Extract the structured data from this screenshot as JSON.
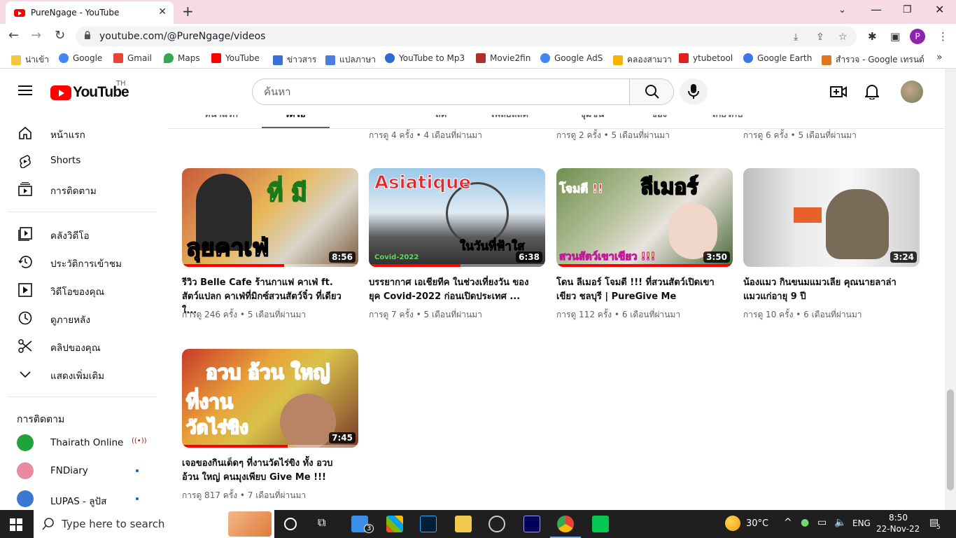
{
  "browser": {
    "tab_title": "PureNgage - YouTube",
    "url": "youtube.com/@PureNgage/videos",
    "profile_letter": "P",
    "bookmarks": [
      {
        "label": "น่าเข้า",
        "color": "#f4c542"
      },
      {
        "label": "Google",
        "color": "#4285f4"
      },
      {
        "label": "Gmail",
        "color": "#ea4335"
      },
      {
        "label": "Maps",
        "color": "#34a853"
      },
      {
        "label": "YouTube",
        "color": "#ff0000"
      },
      {
        "label": "ข่าวสาร",
        "color": "#3b6fd8"
      },
      {
        "label": "แปลภาษา",
        "color": "#4a7ee0"
      },
      {
        "label": "YouTube to Mp3",
        "color": "#2a6ad1"
      },
      {
        "label": "Movie2fin",
        "color": "#b0302a"
      },
      {
        "label": "Google AdS",
        "color": "#4285f4"
      },
      {
        "label": "คลองสามวา",
        "color": "#f4b400"
      },
      {
        "label": "ytubetool",
        "color": "#e02020"
      },
      {
        "label": "Google Earth",
        "color": "#3b78e7"
      },
      {
        "label": "สำรวจ - Google เทรนด์",
        "color": "#e0761f"
      }
    ]
  },
  "header": {
    "logo_text": "YouTube",
    "country_code": "TH",
    "search_placeholder": "ค้นหา"
  },
  "sidebar": {
    "primary": [
      {
        "label": "หน้าแรก",
        "icon": "home-icon"
      },
      {
        "label": "Shorts",
        "icon": "shorts-icon"
      },
      {
        "label": "การติดตาม",
        "icon": "subscriptions-icon"
      }
    ],
    "library": [
      {
        "label": "คลังวิดีโอ",
        "icon": "library-icon"
      },
      {
        "label": "ประวัติการเข้าชม",
        "icon": "history-icon"
      },
      {
        "label": "วิดีโอของคุณ",
        "icon": "your-videos-icon"
      },
      {
        "label": "ดูภายหลัง",
        "icon": "watch-later-icon"
      },
      {
        "label": "คลิปของคุณ",
        "icon": "clips-icon"
      },
      {
        "label": "แสดงเพิ่มเติม",
        "icon": "chevron-down-icon"
      }
    ],
    "subscriptions_title": "การติดตาม",
    "subscriptions": [
      {
        "name": "Thairath Online",
        "status": "live",
        "live_glyph": "((•))",
        "color": "#1fa33a"
      },
      {
        "name": "FNDiary",
        "status": "new",
        "color": "#e88aa0"
      },
      {
        "name": "LUPAS - ลูปัส",
        "status": "new",
        "color": "#3a78d4"
      }
    ]
  },
  "channel_tabs": [
    "หน้าแรก",
    "วิดีโอ",
    "SHORTS",
    "สด",
    "เพลย์ลิสต์",
    "ชุมชน",
    "ช่อง",
    "เกี่ยวกับ"
  ],
  "top_row_meta": [
    "การดู 4 ครั้ง • 4 เดือนที่ผ่านมา",
    "การดู 2 ครั้ง • 5 เดือนที่ผ่านมา",
    "การดู 6 ครั้ง • 5 เดือนที่ผ่านมา"
  ],
  "videos": [
    {
      "title": "รีวิว Belle Cafe ร้านกาแฟ คาเฟ่ ft. สัตว์แปลก คาเฟ่ที่มิกซ์สวนสัตว์จิ๋ว ที่เดียวใ...",
      "meta": "การดู 246 ครั้ง • 5 เดือนที่ผ่านมา",
      "duration": "8:56",
      "progress": 0.58,
      "overlay": [
        "ที่ มี",
        "ลุยคาเฟ่"
      ]
    },
    {
      "title": "บรรยากาศ เอเชียทีค ในช่วงเที่ยงวัน ของยุค Covid-2022 ก่อนเปิดประเทศ ...",
      "meta": "การดู 7 ครั้ง • 5 เดือนที่ผ่านมา",
      "duration": "6:38",
      "progress": 0.52,
      "overlay": [
        "Asiatique",
        "ในวันที่ฟ้าใส",
        "Covid-2022"
      ]
    },
    {
      "title": "โดน ลีเมอร์ โจมตี !!! ที่สวนสัตว์เปิดเขาเขียว ชลบุรี | PureGive Me",
      "meta": "การดู 112 ครั้ง • 6 เดือนที่ผ่านมา",
      "duration": "3:50",
      "progress": 1.0,
      "overlay": [
        "โจมตี !!",
        "ลีเมอร์",
        "สวนสัตว์เขาเขียว !!!"
      ]
    },
    {
      "title": "น้องแมว กินขนมแมวเลีย คุณนายลาล่า แมวแก่อายุ 9 ปี",
      "meta": "การดู 10 ครั้ง • 6 เดือนที่ผ่านมา",
      "duration": "3:24",
      "progress": 0,
      "overlay": []
    },
    {
      "title": "เจอของกินเด็ดๆ ที่งานวัดไร่ขิง ทั้ง อวบ อ้วน ใหญ่ คนมุงเพียบ Give Me !!!",
      "meta": "การดู 817 ครั้ง • 7 เดือนที่ผ่านมา",
      "duration": "7:45",
      "progress": 0.6,
      "overlay": [
        "อวบ อ้วน ใหญ่",
        "ที่งาน",
        "วัดไร่ขิง"
      ]
    }
  ],
  "taskbar": {
    "search_placeholder": "Type here to search",
    "mail_badge": "3",
    "weather": "30°C",
    "language": "ENG",
    "time": "8:50",
    "date": "22-Nov-22",
    "notification_count": "5"
  }
}
